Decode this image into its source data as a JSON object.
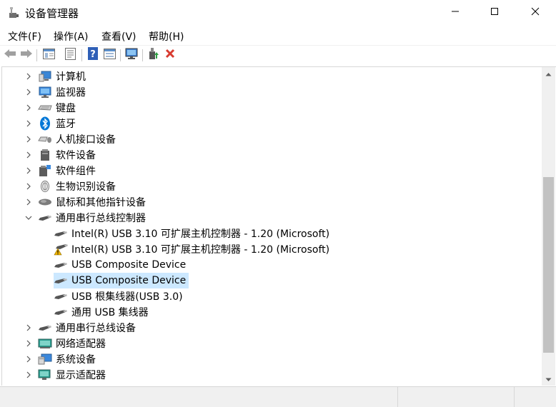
{
  "window": {
    "title": "设备管理器",
    "icon": "device-manager-icon",
    "controls": {
      "minimize": "minimize-icon",
      "maximize": "maximize-icon",
      "close": "close-icon"
    }
  },
  "menu": [
    {
      "label": "文件(F)"
    },
    {
      "label": "操作(A)"
    },
    {
      "label": "查看(V)"
    },
    {
      "label": "帮助(H)"
    }
  ],
  "toolbar": [
    {
      "name": "back-icon"
    },
    {
      "name": "forward-icon"
    },
    {
      "name": "properties-view-icon"
    },
    {
      "name": "device-list-icon"
    },
    {
      "name": "help-icon"
    },
    {
      "name": "resources-view-icon"
    },
    {
      "name": "scan-hardware-icon"
    },
    {
      "name": "update-driver-icon"
    },
    {
      "name": "uninstall-device-icon"
    }
  ],
  "colors": {
    "selection": "#cce8ff",
    "bluetooth": "#0078d7",
    "warning": "#f0b400",
    "uninstall": "#d83b30",
    "scrollbar_thumb": "#c2c2c2"
  },
  "tree": {
    "items": [
      {
        "label": "计算机",
        "icon": "computer-icon",
        "expanded": false,
        "level": 0
      },
      {
        "label": "监视器",
        "icon": "monitor-icon",
        "expanded": false,
        "level": 0
      },
      {
        "label": "键盘",
        "icon": "keyboard-icon",
        "expanded": false,
        "level": 0
      },
      {
        "label": "蓝牙",
        "icon": "bluetooth-icon",
        "expanded": false,
        "level": 0
      },
      {
        "label": "人机接口设备",
        "icon": "hid-icon",
        "expanded": false,
        "level": 0
      },
      {
        "label": "软件设备",
        "icon": "software-device-icon",
        "expanded": false,
        "level": 0
      },
      {
        "label": "软件组件",
        "icon": "software-component-icon",
        "expanded": false,
        "level": 0
      },
      {
        "label": "生物识别设备",
        "icon": "biometric-icon",
        "expanded": false,
        "level": 0
      },
      {
        "label": "鼠标和其他指针设备",
        "icon": "mouse-icon",
        "expanded": false,
        "level": 0
      },
      {
        "label": "通用串行总线控制器",
        "icon": "usb-controller-icon",
        "expanded": true,
        "level": 0
      },
      {
        "label": "Intel(R) USB 3.10 可扩展主机控制器 - 1.20 (Microsoft)",
        "icon": "usb-icon",
        "level": 1
      },
      {
        "label": "Intel(R) USB 3.10 可扩展主机控制器 - 1.20 (Microsoft)",
        "icon": "usb-warning-icon",
        "level": 1
      },
      {
        "label": "USB Composite Device",
        "icon": "usb-icon",
        "level": 1
      },
      {
        "label": "USB Composite Device",
        "icon": "usb-icon",
        "level": 1,
        "selected": true
      },
      {
        "label": "USB 根集线器(USB 3.0)",
        "icon": "usb-icon",
        "level": 1
      },
      {
        "label": "通用 USB 集线器",
        "icon": "usb-icon",
        "level": 1
      },
      {
        "label": "通用串行总线设备",
        "icon": "usb-device-icon",
        "expanded": false,
        "level": 0
      },
      {
        "label": "网络适配器",
        "icon": "network-adapter-icon",
        "expanded": false,
        "level": 0
      },
      {
        "label": "系统设备",
        "icon": "system-device-icon",
        "expanded": false,
        "level": 0
      },
      {
        "label": "显示适配器",
        "icon": "display-adapter-icon",
        "expanded": false,
        "level": 0
      }
    ]
  }
}
